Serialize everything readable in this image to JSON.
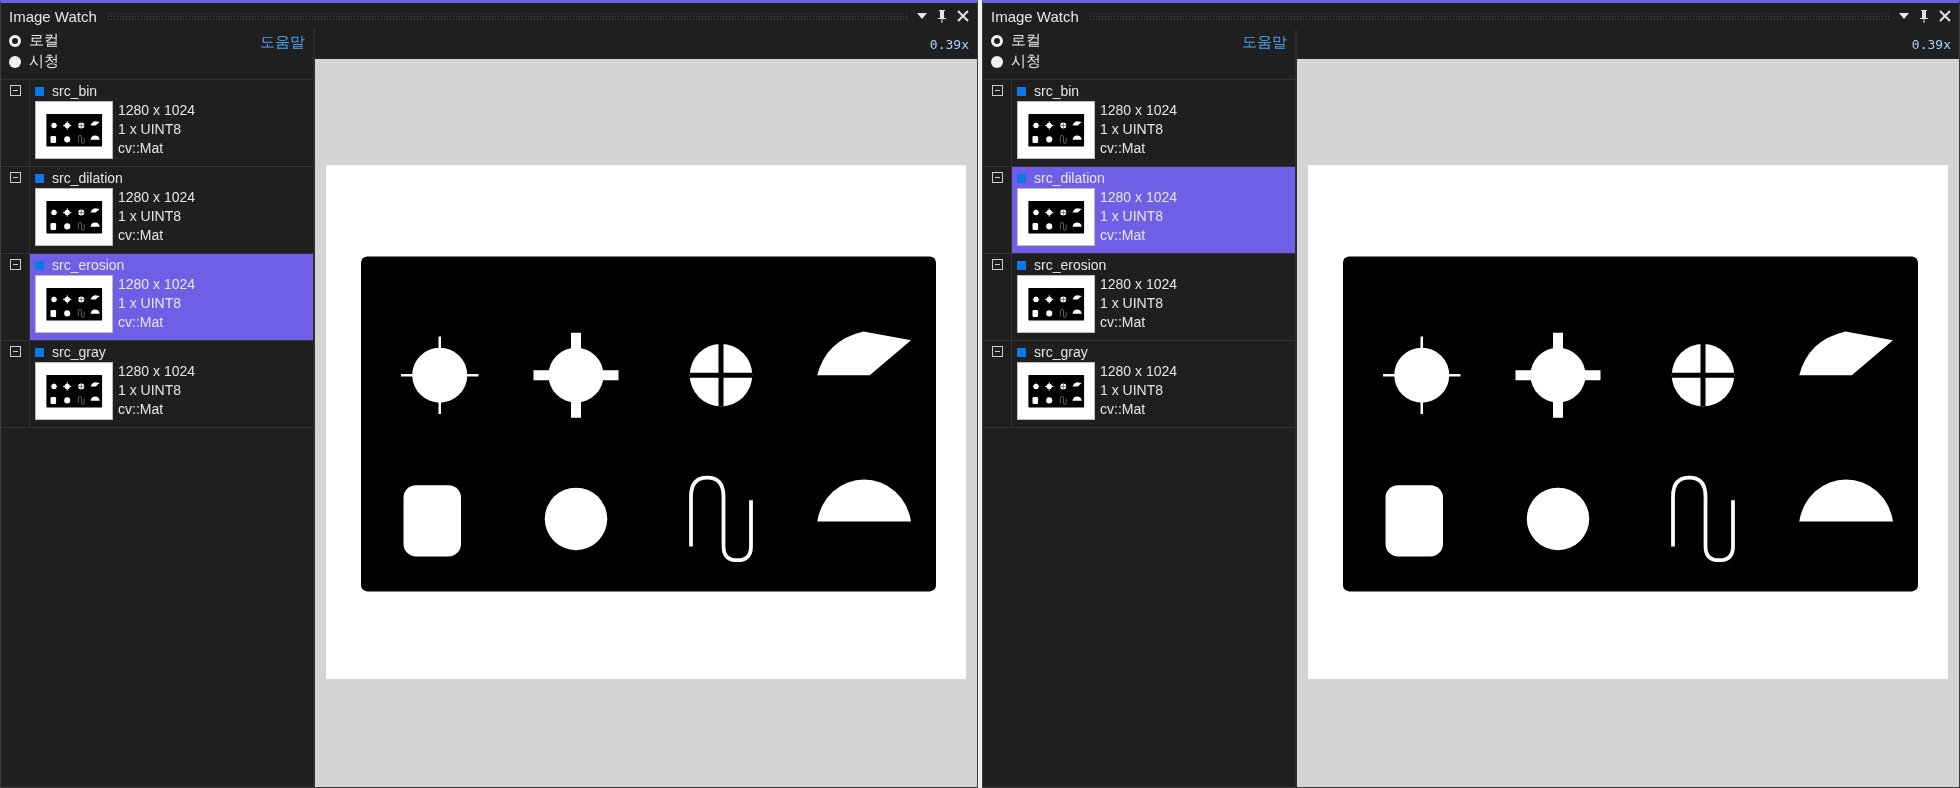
{
  "panels": [
    {
      "title": "Image Watch",
      "radios": [
        {
          "label": "로컬",
          "selected": true
        },
        {
          "label": "시청",
          "selected": false
        }
      ],
      "help_link": "도움말",
      "zoom": "0.39x",
      "items": [
        {
          "name": "src_bin",
          "size": "1280 x 1024",
          "type": "1 x UINT8",
          "class": "cv::Mat",
          "selected": false
        },
        {
          "name": "src_dilation",
          "size": "1280 x 1024",
          "type": "1 x UINT8",
          "class": "cv::Mat",
          "selected": false
        },
        {
          "name": "src_erosion",
          "size": "1280 x 1024",
          "type": "1 x UINT8",
          "class": "cv::Mat",
          "selected": true
        },
        {
          "name": "src_gray",
          "size": "1280 x 1024",
          "type": "1 x UINT8",
          "class": "cv::Mat",
          "selected": false
        }
      ]
    },
    {
      "title": "Image Watch",
      "radios": [
        {
          "label": "로컬",
          "selected": true
        },
        {
          "label": "시청",
          "selected": false
        }
      ],
      "help_link": "도움말",
      "zoom": "0.39x",
      "items": [
        {
          "name": "src_bin",
          "size": "1280 x 1024",
          "type": "1 x UINT8",
          "class": "cv::Mat",
          "selected": false
        },
        {
          "name": "src_dilation",
          "size": "1280 x 1024",
          "type": "1 x UINT8",
          "class": "cv::Mat",
          "selected": true
        },
        {
          "name": "src_erosion",
          "size": "1280 x 1024",
          "type": "1 x UINT8",
          "class": "cv::Mat",
          "selected": false
        },
        {
          "name": "src_gray",
          "size": "1280 x 1024",
          "type": "1 x UINT8",
          "class": "cv::Mat",
          "selected": false
        }
      ]
    }
  ]
}
